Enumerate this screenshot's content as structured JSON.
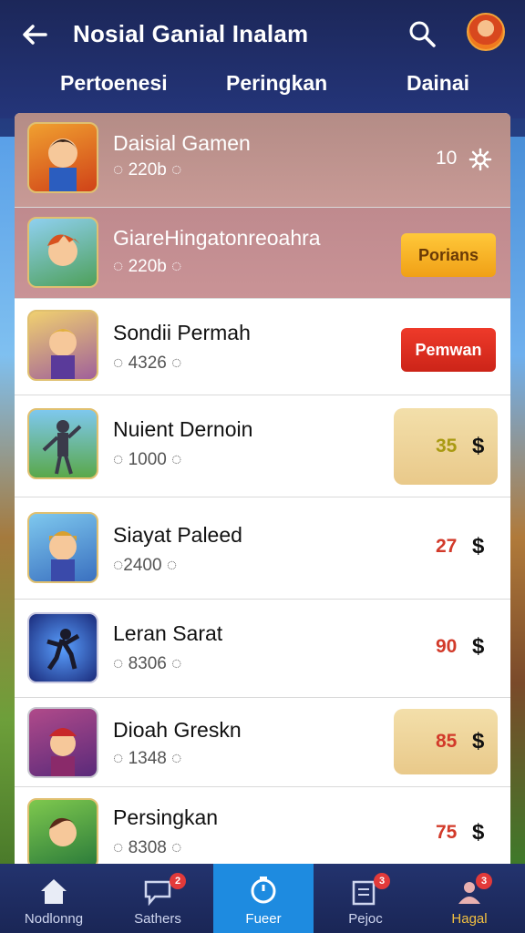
{
  "header": {
    "title": "Nosial Ganial Inalam",
    "tabs": [
      "Pertoenesi",
      "Peringkan",
      "Dainai"
    ]
  },
  "rows": [
    {
      "name": "Daisial Gamen",
      "meta": "220b",
      "value": "10"
    },
    {
      "name": "GiareHingatonreoahra",
      "meta": "220b",
      "button": "Porians"
    },
    {
      "name": "Sondii Permah",
      "meta": "4326",
      "button": "Pemwan"
    },
    {
      "name": "Nuient Dernoin",
      "meta": "1000",
      "price": "35",
      "currency": "$"
    },
    {
      "name": "Siayat Paleed",
      "meta": "2400",
      "price": "27",
      "currency": "$"
    },
    {
      "name": "Leran Sarat",
      "meta": "8306",
      "price": "90",
      "currency": "$"
    },
    {
      "name": "Dioah Greskn",
      "meta": "1348",
      "price": "85",
      "currency": "$"
    },
    {
      "name": "Persingkan",
      "meta": "8308",
      "price": "75",
      "currency": "$"
    }
  ],
  "bottom_nav": [
    {
      "label": "Nodlonng",
      "badge": ""
    },
    {
      "label": "Sathers",
      "badge": "2"
    },
    {
      "label": "Fueer",
      "badge": ""
    },
    {
      "label": "Pejoc",
      "badge": "3"
    },
    {
      "label": "Hagal",
      "badge": "3"
    }
  ],
  "colors": {
    "header_bg": "#1c2759",
    "accent_blue": "#1e8be0",
    "button_yellow": "#f5b21a",
    "button_red": "#e2342a",
    "price_yellow_text": "#a99a12",
    "price_red_text": "#d23a2a"
  }
}
